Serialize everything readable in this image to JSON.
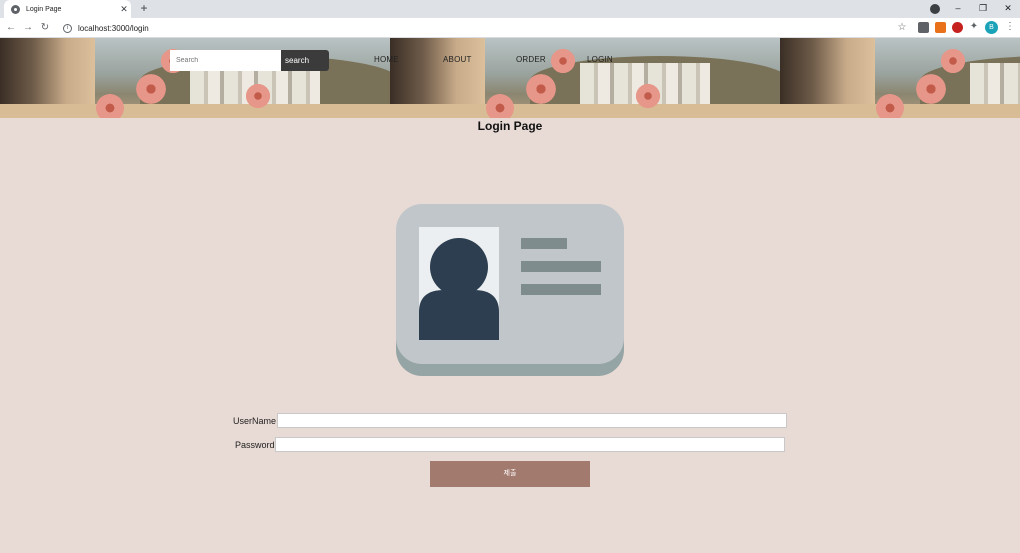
{
  "browser": {
    "tab_title": "Login Page",
    "tab_close": "✕",
    "new_tab": "+",
    "url": "localhost:3000/login",
    "controls": {
      "minimize": "–",
      "restore": "❐",
      "close": "✕"
    },
    "nav": {
      "back": "←",
      "forward": "→",
      "reload": "↻",
      "star": "☆",
      "extensions": "✦",
      "menu": "⋮"
    },
    "profile_initial": "B"
  },
  "header": {
    "search": {
      "placeholder": "Search",
      "button_label": "search"
    },
    "nav_items": [
      "HOME",
      "ABOUT",
      "ORDER",
      "LOGIN"
    ]
  },
  "main": {
    "title": "Login Page",
    "form": {
      "username_label": "UserName",
      "password_label": "Password",
      "username_value": "",
      "password_value": "",
      "submit_label": "제출"
    }
  },
  "colors": {
    "page_bg": "#e8dad4",
    "submit_bg": "#a37a6e",
    "card_bg": "#c0c6ca",
    "card_shadow": "#95a5a6",
    "avatar": "#2c3e50",
    "lines": "#7f8c8d"
  },
  "icons": {
    "card": "id-card-icon"
  }
}
